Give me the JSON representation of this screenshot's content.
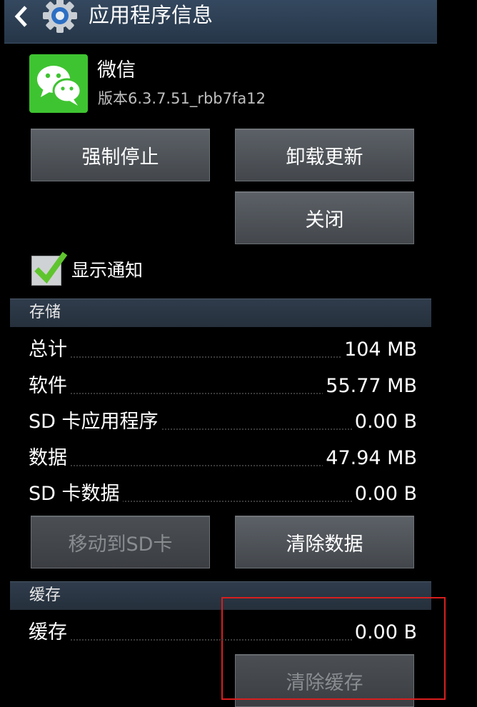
{
  "header": {
    "title": "应用程序信息"
  },
  "app": {
    "name": "微信",
    "version": "版本6.3.7.51_rbb7fa12"
  },
  "buttons": {
    "force_stop": "强制停止",
    "uninstall_updates": "卸载更新",
    "close": "关闭",
    "move_to_sd": "移动到SD卡",
    "clear_data": "清除数据",
    "clear_cache": "清除缓存"
  },
  "notifications": {
    "label": "显示通知",
    "checked": true
  },
  "storage": {
    "header": "存储",
    "rows": [
      {
        "label": "总计",
        "value": "104 MB"
      },
      {
        "label": "软件",
        "value": "55.77 MB"
      },
      {
        "label": "SD 卡应用程序",
        "value": "0.00 B"
      },
      {
        "label": "数据",
        "value": "47.94 MB"
      },
      {
        "label": "SD 卡数据",
        "value": "0.00 B"
      }
    ]
  },
  "cache": {
    "header": "缓存",
    "rows": [
      {
        "label": "缓存",
        "value": "0.00 B"
      }
    ]
  },
  "colors": {
    "actionbar": "#2c3e54",
    "app_icon": "#3fc431",
    "check": "#5fc52e",
    "highlight": "#d81e1e"
  }
}
